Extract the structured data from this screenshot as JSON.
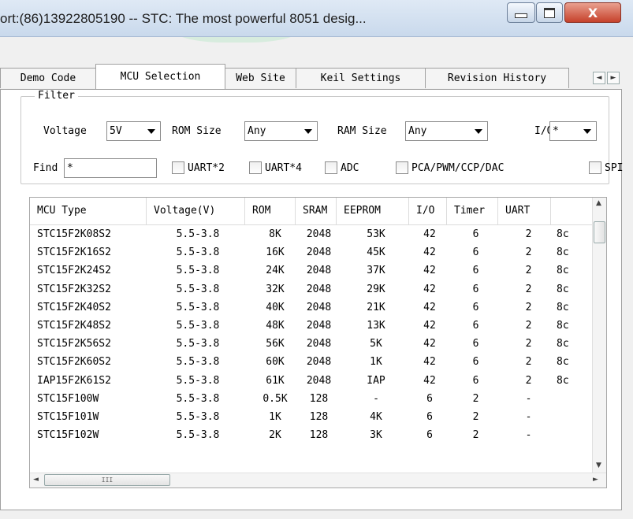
{
  "window": {
    "title": "ort:(86)13922805190  -- STC: The most powerful 8051 desig..."
  },
  "tabs": [
    {
      "label": "Demo Code"
    },
    {
      "label": "MCU Selection"
    },
    {
      "label": "Web Site"
    },
    {
      "label": "Keil Settings"
    },
    {
      "label": "Revision History"
    }
  ],
  "filter": {
    "title": "Filter",
    "voltage_label": "Voltage",
    "voltage_value": "5V",
    "rom_label": "ROM Size",
    "rom_value": "Any",
    "ram_label": "RAM Size",
    "ram_value": "Any",
    "io_label": "I/O",
    "io_value": "*",
    "find_label": "Find",
    "find_value": "*",
    "checks": [
      {
        "label": "UART*2"
      },
      {
        "label": "UART*4"
      },
      {
        "label": "ADC"
      },
      {
        "label": "PCA/PWM/CCP/DAC"
      },
      {
        "label": "SPI"
      }
    ]
  },
  "grid": {
    "columns": [
      "MCU Type",
      "Voltage(V)",
      "ROM",
      "SRAM",
      "EEPROM",
      "I/O",
      "Timer",
      "UART",
      ""
    ],
    "rows": [
      [
        "STC15F2K08S2",
        "5.5-3.8",
        "8K",
        "2048",
        "53K",
        "42",
        "6",
        "2",
        "8c"
      ],
      [
        "STC15F2K16S2",
        "5.5-3.8",
        "16K",
        "2048",
        "45K",
        "42",
        "6",
        "2",
        "8c"
      ],
      [
        "STC15F2K24S2",
        "5.5-3.8",
        "24K",
        "2048",
        "37K",
        "42",
        "6",
        "2",
        "8c"
      ],
      [
        "STC15F2K32S2",
        "5.5-3.8",
        "32K",
        "2048",
        "29K",
        "42",
        "6",
        "2",
        "8c"
      ],
      [
        "STC15F2K40S2",
        "5.5-3.8",
        "40K",
        "2048",
        "21K",
        "42",
        "6",
        "2",
        "8c"
      ],
      [
        "STC15F2K48S2",
        "5.5-3.8",
        "48K",
        "2048",
        "13K",
        "42",
        "6",
        "2",
        "8c"
      ],
      [
        "STC15F2K56S2",
        "5.5-3.8",
        "56K",
        "2048",
        "5K",
        "42",
        "6",
        "2",
        "8c"
      ],
      [
        "STC15F2K60S2",
        "5.5-3.8",
        "60K",
        "2048",
        "1K",
        "42",
        "6",
        "2",
        "8c"
      ],
      [
        "IAP15F2K61S2",
        "5.5-3.8",
        "61K",
        "2048",
        "IAP",
        "42",
        "6",
        "2",
        "8c"
      ],
      [
        "STC15F100W",
        "5.5-3.8",
        "0.5K",
        "128",
        "-",
        "6",
        "2",
        "-",
        ""
      ],
      [
        "STC15F101W",
        "5.5-3.8",
        "1K",
        "128",
        "4K",
        "6",
        "2",
        "-",
        ""
      ],
      [
        "STC15F102W",
        "5.5-3.8",
        "2K",
        "128",
        "3K",
        "6",
        "2",
        "-",
        ""
      ]
    ]
  },
  "scroll_glyphs": {
    "up": "▲",
    "down": "▼",
    "left": "◄",
    "right": "►",
    "grip": "III"
  }
}
